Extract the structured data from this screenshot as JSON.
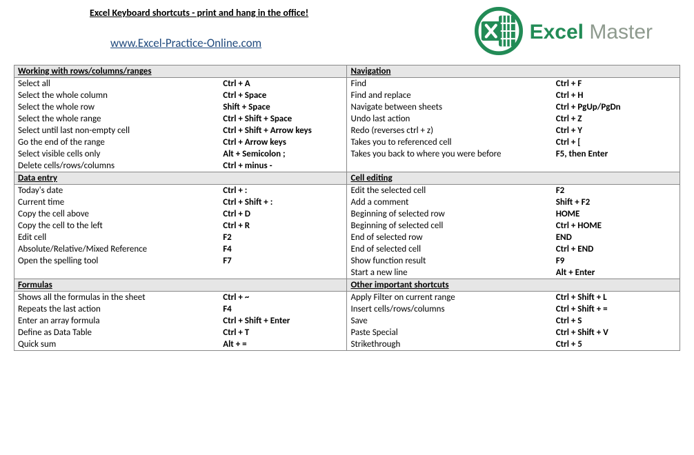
{
  "header": {
    "title": "Excel Keyboard shortcuts - print and hang in the office!",
    "link": "www.Excel-Practice-Online.com",
    "logo_brand": "Excel",
    "logo_word": "Master"
  },
  "sections": {
    "rows_cols": {
      "title": "Working with rows/columns/ranges",
      "items": [
        {
          "desc": "Select all",
          "key": "Ctrl + A"
        },
        {
          "desc": "Select the whole column",
          "key": "Ctrl + Space"
        },
        {
          "desc": "Select the whole row",
          "key": "Shift + Space"
        },
        {
          "desc": "Select the whole range",
          "key": "Ctrl + Shift + Space"
        },
        {
          "desc": "Select until last non-empty cell",
          "key": "Ctrl + Shift + Arrow keys"
        },
        {
          "desc": "Go the end of the range",
          "key": "Ctrl + Arrow keys"
        },
        {
          "desc": "Select visible cells only",
          "key": "Alt + Semicolon ;"
        },
        {
          "desc": "Delete cells/rows/columns",
          "key": "Ctrl + minus -"
        }
      ]
    },
    "navigation": {
      "title": "Navigation",
      "items": [
        {
          "desc": "Find",
          "key": "Ctrl + F"
        },
        {
          "desc": "Find and replace",
          "key": "Ctrl + H"
        },
        {
          "desc": "Navigate between sheets",
          "key": "Ctrl + PgUp/PgDn"
        },
        {
          "desc": "Undo last action",
          "key": "Ctrl + Z"
        },
        {
          "desc": "Redo (reverses ctrl + z)",
          "key": "Ctrl + Y"
        },
        {
          "desc": "Takes you to referenced cell",
          "key": "Ctrl + ["
        },
        {
          "desc": "Takes you back to where you were before",
          "key": "F5, then Enter"
        },
        {
          "desc": "",
          "key": ""
        }
      ]
    },
    "data_entry": {
      "title": "Data entry",
      "items": [
        {
          "desc": "Today's date",
          "key": "Ctrl + :"
        },
        {
          "desc": "Current time",
          "key": "Ctrl + Shift + :"
        },
        {
          "desc": "Copy the cell above",
          "key": "Ctrl + D"
        },
        {
          "desc": "Copy the cell to the left",
          "key": "Ctrl + R"
        },
        {
          "desc": "Edit cell",
          "key": "F2"
        },
        {
          "desc": "Absolute/Relative/Mixed Reference",
          "key": "F4"
        },
        {
          "desc": "Open the spelling tool",
          "key": "F7"
        },
        {
          "desc": "",
          "key": ""
        }
      ]
    },
    "cell_editing": {
      "title": "Cell editing",
      "items": [
        {
          "desc": "Edit the selected cell",
          "key": "F2"
        },
        {
          "desc": "Add a comment",
          "key": "Shift + F2"
        },
        {
          "desc": "Beginning of selected row",
          "key": "HOME"
        },
        {
          "desc": "Beginning of selected cell",
          "key": "Ctrl + HOME"
        },
        {
          "desc": "End of selected row",
          "key": "END"
        },
        {
          "desc": "End of selected cell",
          "key": "Ctrl + END"
        },
        {
          "desc": "Show function result",
          "key": "F9"
        },
        {
          "desc": "Start a new line",
          "key": "Alt + Enter"
        }
      ]
    },
    "formulas": {
      "title": "Formulas",
      "items": [
        {
          "desc": "Shows all the formulas in the sheet",
          "key": "Ctrl + ~"
        },
        {
          "desc": "Repeats the last action",
          "key": "F4"
        },
        {
          "desc": "Enter an array formula",
          "key": "Ctrl + Shift + Enter"
        },
        {
          "desc": "Define as Data Table",
          "key": "Ctrl + T"
        },
        {
          "desc": "Quick sum",
          "key": "Alt + ="
        }
      ]
    },
    "other": {
      "title": "Other important shortcuts",
      "items": [
        {
          "desc": "Apply Filter on current range",
          "key": "Ctrl + Shift + L"
        },
        {
          "desc": "Insert cells/rows/columns",
          "key": "Ctrl + Shift + ="
        },
        {
          "desc": "Save",
          "key": "Ctrl + S"
        },
        {
          "desc": "Paste Special",
          "key": "Ctrl + Shift + V"
        },
        {
          "desc": "Strikethrough",
          "key": "Ctrl + 5"
        }
      ]
    }
  }
}
